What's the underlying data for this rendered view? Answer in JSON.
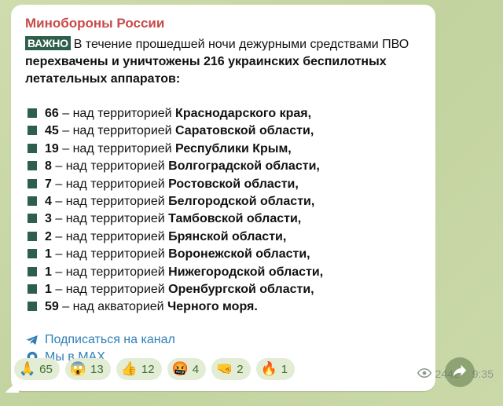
{
  "message": {
    "channel": "Минобороны России",
    "badge": "ВАЖНО",
    "intro_plain": "В течение прошедшей ночи дежурными средствами ПВО",
    "intro_bold": "перехвачены и уничтожены 216 украинских беспилотных летательных аппаратов:",
    "items": [
      {
        "num": "66",
        "text": " – над территорией ",
        "region": "Краснодарского края,"
      },
      {
        "num": "45",
        "text": " – над территорией ",
        "region": "Саратовской области,"
      },
      {
        "num": "19",
        "text": " – над территорией ",
        "region": "Республики Крым,"
      },
      {
        "num": "8",
        "text": " – над территорией ",
        "region": "Волгоградской области,"
      },
      {
        "num": "7",
        "text": " – над территорией ",
        "region": "Ростовской области,"
      },
      {
        "num": "4",
        "text": " – над территорией ",
        "region": "Белгородской области,"
      },
      {
        "num": "3",
        "text": " – над территорией ",
        "region": "Тамбовской области,"
      },
      {
        "num": "2",
        "text": " – над территорией ",
        "region": "Брянской области,"
      },
      {
        "num": "1",
        "text": " – над территорией ",
        "region": "Воронежской области,"
      },
      {
        "num": "1",
        "text": " – над территорией ",
        "region": "Нижегородской области,"
      },
      {
        "num": "1",
        "text": " – над территорией ",
        "region": "Оренбургской области,"
      },
      {
        "num": "59",
        "text": " – над акваторией ",
        "region": "Черного моря."
      }
    ],
    "links": {
      "subscribe": "Подписаться на канал",
      "max": "Мы в MAX"
    },
    "reactions": [
      {
        "emoji": "🙏",
        "count": "65"
      },
      {
        "emoji": "😱",
        "count": "13"
      },
      {
        "emoji": "👍",
        "count": "12"
      },
      {
        "emoji": "🤬",
        "count": "4"
      },
      {
        "emoji": "🤜",
        "count": "2"
      },
      {
        "emoji": "🔥",
        "count": "1"
      }
    ],
    "views": "2442",
    "time": "9:35"
  },
  "colors": {
    "accent": "#2d5f4c",
    "channel": "#c94a4a",
    "link": "#2f7fb6"
  }
}
